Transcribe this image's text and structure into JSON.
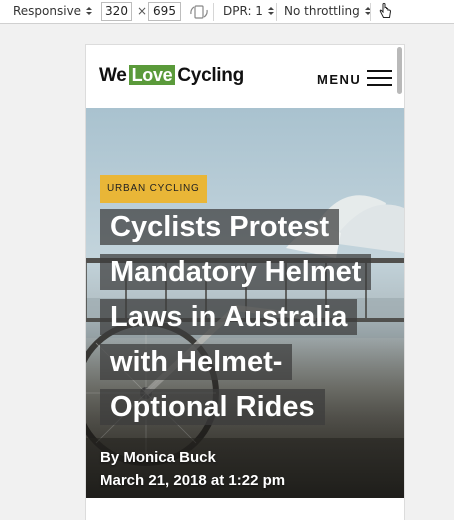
{
  "devtools": {
    "device_label": "Responsive",
    "width_value": "320",
    "times_symbol": "×",
    "height_value": "695",
    "dpr_label": "DPR: 1",
    "throttle_label": "No throttling"
  },
  "site": {
    "logo_we": "We",
    "logo_love": "Love",
    "logo_cycling": "Cycling",
    "menu_label": "MENU"
  },
  "article": {
    "category": "URBAN CYCLING",
    "title": "Cyclists Protest Mandatory Helmet Laws in Australia with Helmet-Optional Rides",
    "author_line": "By Monica Buck",
    "date_line": "March 21, 2018 at 1:22 pm"
  },
  "colors": {
    "badge": "#e9b637",
    "logo_love_bg": "#5a9a3a"
  }
}
